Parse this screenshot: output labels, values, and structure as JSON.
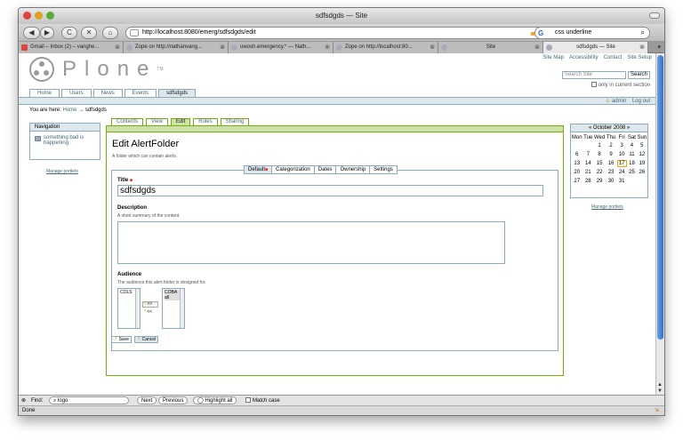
{
  "window": {
    "title": "sdfsdgds — Site"
  },
  "nav": {
    "back_icon": "◀",
    "fwd_icon": "▶",
    "reload_icon": "C",
    "stop_icon": "✕",
    "home_icon": "⌂",
    "url": "http://localhost:8080/emerg/sdfsdgds/edit",
    "search_engine": "G",
    "search_value": "css underline"
  },
  "tabs": [
    {
      "label": "Gmail – Inbox (2) – vanghe...",
      "active": false
    },
    {
      "label": "Zope on http://nathanvang...",
      "active": false
    },
    {
      "label": "uwosh.emergency.* — Nath...",
      "active": false
    },
    {
      "label": "Zope on http://localhost:80...",
      "active": false
    },
    {
      "label": "Site",
      "active": false
    },
    {
      "label": "sdfsdgds — Site",
      "active": true
    }
  ],
  "site": {
    "logo": "Plone",
    "logo_tm": "TM",
    "actions": [
      "Site Map",
      "Accessibility",
      "Contact",
      "Site Setup"
    ],
    "search_placeholder": "Search Site",
    "search_button": "Search",
    "only_current": "only in current section",
    "portal_tabs": [
      "Home",
      "Users",
      "News",
      "Events",
      "sdfsdgds"
    ],
    "user": "admin",
    "logout": "Log out",
    "breadcrumb_prefix": "You are here:",
    "breadcrumb_home": "Home",
    "breadcrumb_sep": "→",
    "breadcrumb_current": "sdfsdgds"
  },
  "navigation": {
    "header": "Navigation",
    "item": "something bad is happening",
    "manage": "Manage portlets"
  },
  "content": {
    "tabs": [
      "Contents",
      "View",
      "Edit",
      "Rules",
      "Sharing"
    ],
    "title": "Edit AlertFolder",
    "description": "A folder which can contain alerts.",
    "fieldset_tabs": [
      "Default",
      "Categorization",
      "Dates",
      "Ownership",
      "Settings"
    ],
    "title_label": "Title",
    "title_value": "sdfsdgds",
    "desc_label": "Description",
    "desc_help": "A short summary of the content.",
    "audience_label": "Audience",
    "audience_help": "The audience this alert folder is designed for.",
    "audience_available": [
      "COLS"
    ],
    "audience_selected": [
      "COBA",
      "all"
    ],
    "add_btn": ">>",
    "remove_btn": "<<",
    "save": "Save",
    "cancel": "Cancel"
  },
  "calendar": {
    "header": "« October 2008 »",
    "days": [
      "Mon",
      "Tue",
      "Wed",
      "Thu",
      "Fri",
      "Sat",
      "Sun"
    ],
    "weeks": [
      [
        "",
        "",
        "1",
        "2",
        "3",
        "4",
        "5"
      ],
      [
        "6",
        "7",
        "8",
        "9",
        "10",
        "11",
        "12"
      ],
      [
        "13",
        "14",
        "15",
        "16",
        "17",
        "18",
        "19"
      ],
      [
        "20",
        "21",
        "22",
        "23",
        "24",
        "25",
        "26"
      ],
      [
        "27",
        "28",
        "29",
        "30",
        "31",
        "",
        ""
      ]
    ],
    "today": "17",
    "manage": "Manage portlets"
  },
  "findbar": {
    "label": "Find:",
    "value": "logo",
    "next": "Next",
    "previous": "Previous",
    "highlight": "Highlight all",
    "match_case": "Match case"
  },
  "status": {
    "text": "Done"
  }
}
